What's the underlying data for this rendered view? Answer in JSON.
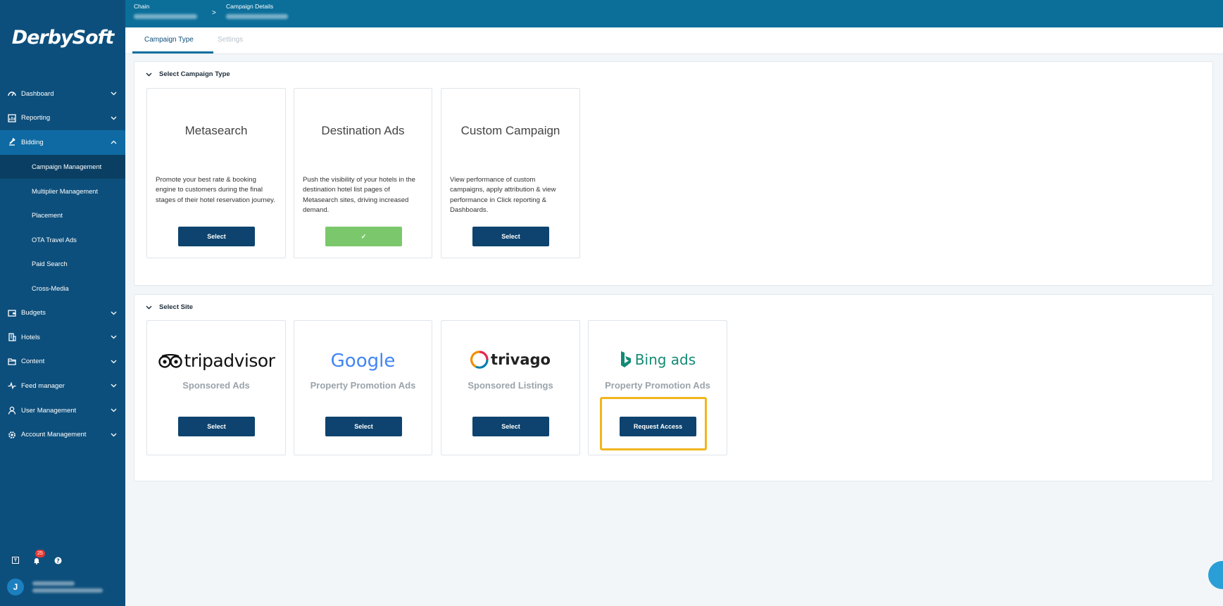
{
  "brand": {
    "logo_text": "DerbySoft"
  },
  "breadcrumb": {
    "first_label": "Chain",
    "second_label": "Campaign Details",
    "separator": ">"
  },
  "tabs": [
    {
      "label": "Campaign Type"
    },
    {
      "label": "Settings"
    }
  ],
  "sidebar": {
    "items": [
      {
        "label": "Dashboard",
        "icon": "dashboard-icon"
      },
      {
        "label": "Reporting",
        "icon": "reporting-icon"
      },
      {
        "label": "Bidding",
        "icon": "bidding-icon"
      },
      {
        "label": "Budgets",
        "icon": "wallet-icon"
      },
      {
        "label": "Hotels",
        "icon": "building-icon"
      },
      {
        "label": "Content",
        "icon": "folder-icon"
      },
      {
        "label": "Feed manager",
        "icon": "pulse-icon"
      },
      {
        "label": "User Management",
        "icon": "user-icon"
      },
      {
        "label": "Account Management",
        "icon": "gear-icon"
      }
    ],
    "bidding_sub": [
      {
        "label": "Campaign Management"
      },
      {
        "label": "Multiplier Management"
      },
      {
        "label": "Placement"
      },
      {
        "label": "OTA Travel Ads"
      },
      {
        "label": "Paid Search"
      },
      {
        "label": "Cross-Media"
      }
    ],
    "footer": {
      "notification_count": "25",
      "avatar_initial": "J"
    }
  },
  "campaign_type": {
    "header": "Select Campaign Type",
    "cards": [
      {
        "title": "Metasearch",
        "description": "Promote your best rate & booking engine to customers during the final stages of their hotel reservation journey.",
        "button": "Select"
      },
      {
        "title": "Destination Ads",
        "description": "Push the visibility of your hotels in the destination hotel list pages of Metasearch sites, driving increased demand.",
        "button": "✓"
      },
      {
        "title": "Custom Campaign",
        "description": "View performance of custom campaigns, apply attribution & view performance in Click reporting & Dashboards.",
        "button": "Select"
      }
    ]
  },
  "sites": {
    "header": "Select Site",
    "cards": [
      {
        "logo": "tripadvisor",
        "subtitle": "Sponsored Ads",
        "button": "Select"
      },
      {
        "logo": "Google",
        "subtitle": "Property Promotion Ads",
        "button": "Select"
      },
      {
        "logo": "trivago",
        "subtitle": "Sponsored Listings",
        "button": "Select"
      },
      {
        "logo": "Bing ads",
        "subtitle": "Property Promotion Ads",
        "button": "Request Access"
      }
    ]
  },
  "colors": {
    "sidebar": "#0d4f7c",
    "topbar": "#0b6f9a",
    "button": "#0d436e",
    "selected_button": "#7bc86c",
    "highlight": "#f2b51d"
  }
}
